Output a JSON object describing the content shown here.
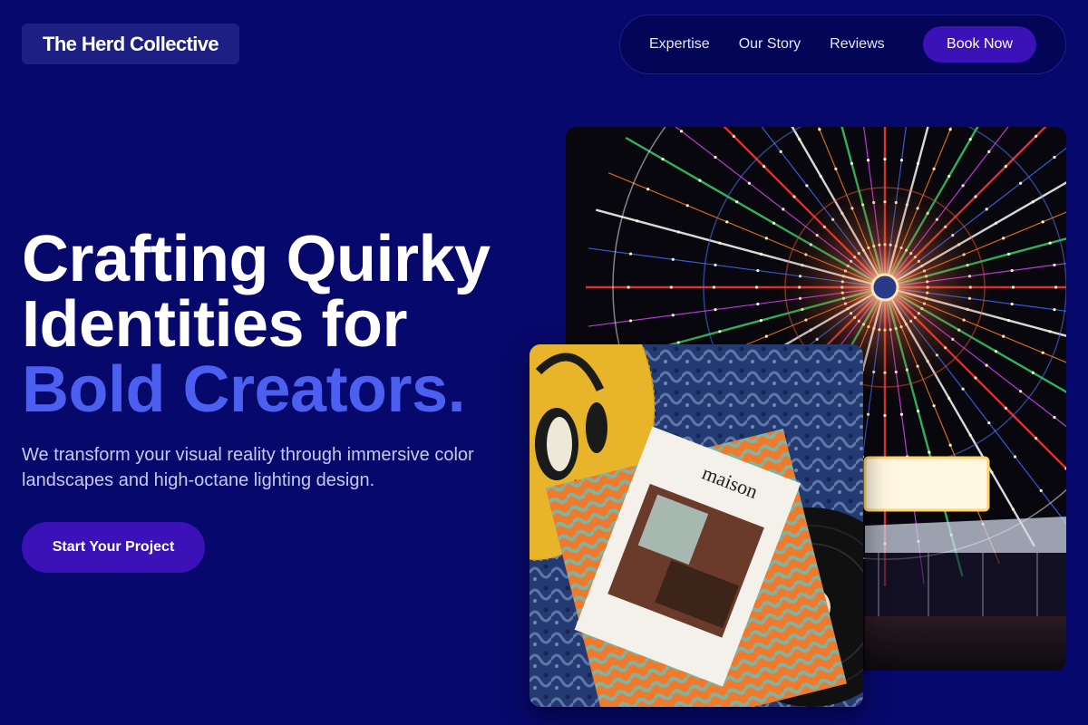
{
  "header": {
    "logo_text": "The Herd Collective",
    "nav": {
      "links": [
        "Expertise",
        "Our Story",
        "Reviews"
      ],
      "cta_label": "Book Now"
    }
  },
  "hero": {
    "headline_line1": "Crafting Quirky",
    "headline_line2": "Identities for",
    "headline_accent": "Bold Creators.",
    "subtext": "We transform your visual reality through immersive color landscapes and high-octane lighting design.",
    "cta_label": "Start Your Project"
  },
  "images": {
    "flatlay_magazine_title": "maison"
  },
  "colors": {
    "background": "#07086b",
    "accent_text": "#4b5ff0",
    "button": "#3b12b8",
    "nav_bg": "#050558"
  }
}
